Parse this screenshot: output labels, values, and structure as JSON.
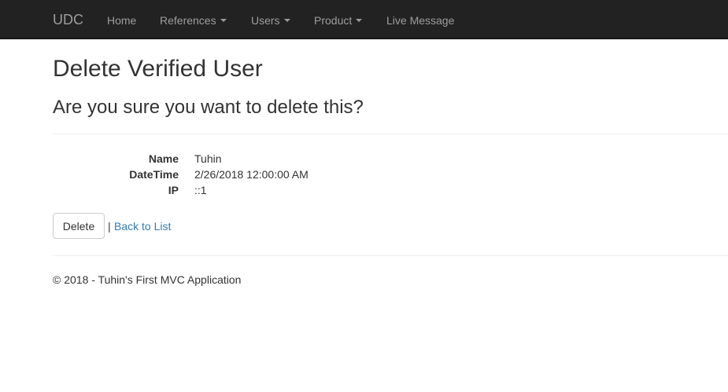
{
  "navbar": {
    "brand": "UDC",
    "items": [
      {
        "label": "Home",
        "dropdown": false
      },
      {
        "label": "References",
        "dropdown": true
      },
      {
        "label": "Users",
        "dropdown": true
      },
      {
        "label": "Product",
        "dropdown": true
      },
      {
        "label": "Live Message",
        "dropdown": false
      }
    ]
  },
  "page": {
    "title": "Delete Verified User",
    "confirm": "Are you sure you want to delete this?"
  },
  "details": [
    {
      "label": "Name",
      "value": "Tuhin"
    },
    {
      "label": "DateTime",
      "value": "2/26/2018 12:00:00 AM"
    },
    {
      "label": "IP",
      "value": "::1"
    }
  ],
  "actions": {
    "delete_label": "Delete",
    "separator": "|",
    "back_label": "Back to List"
  },
  "footer": {
    "text": "© 2018 - Tuhin's First MVC Application"
  },
  "colors": {
    "navbar_bg": "#222222",
    "nav_text": "#9d9d9d",
    "link": "#337ab7",
    "text": "#333333"
  }
}
